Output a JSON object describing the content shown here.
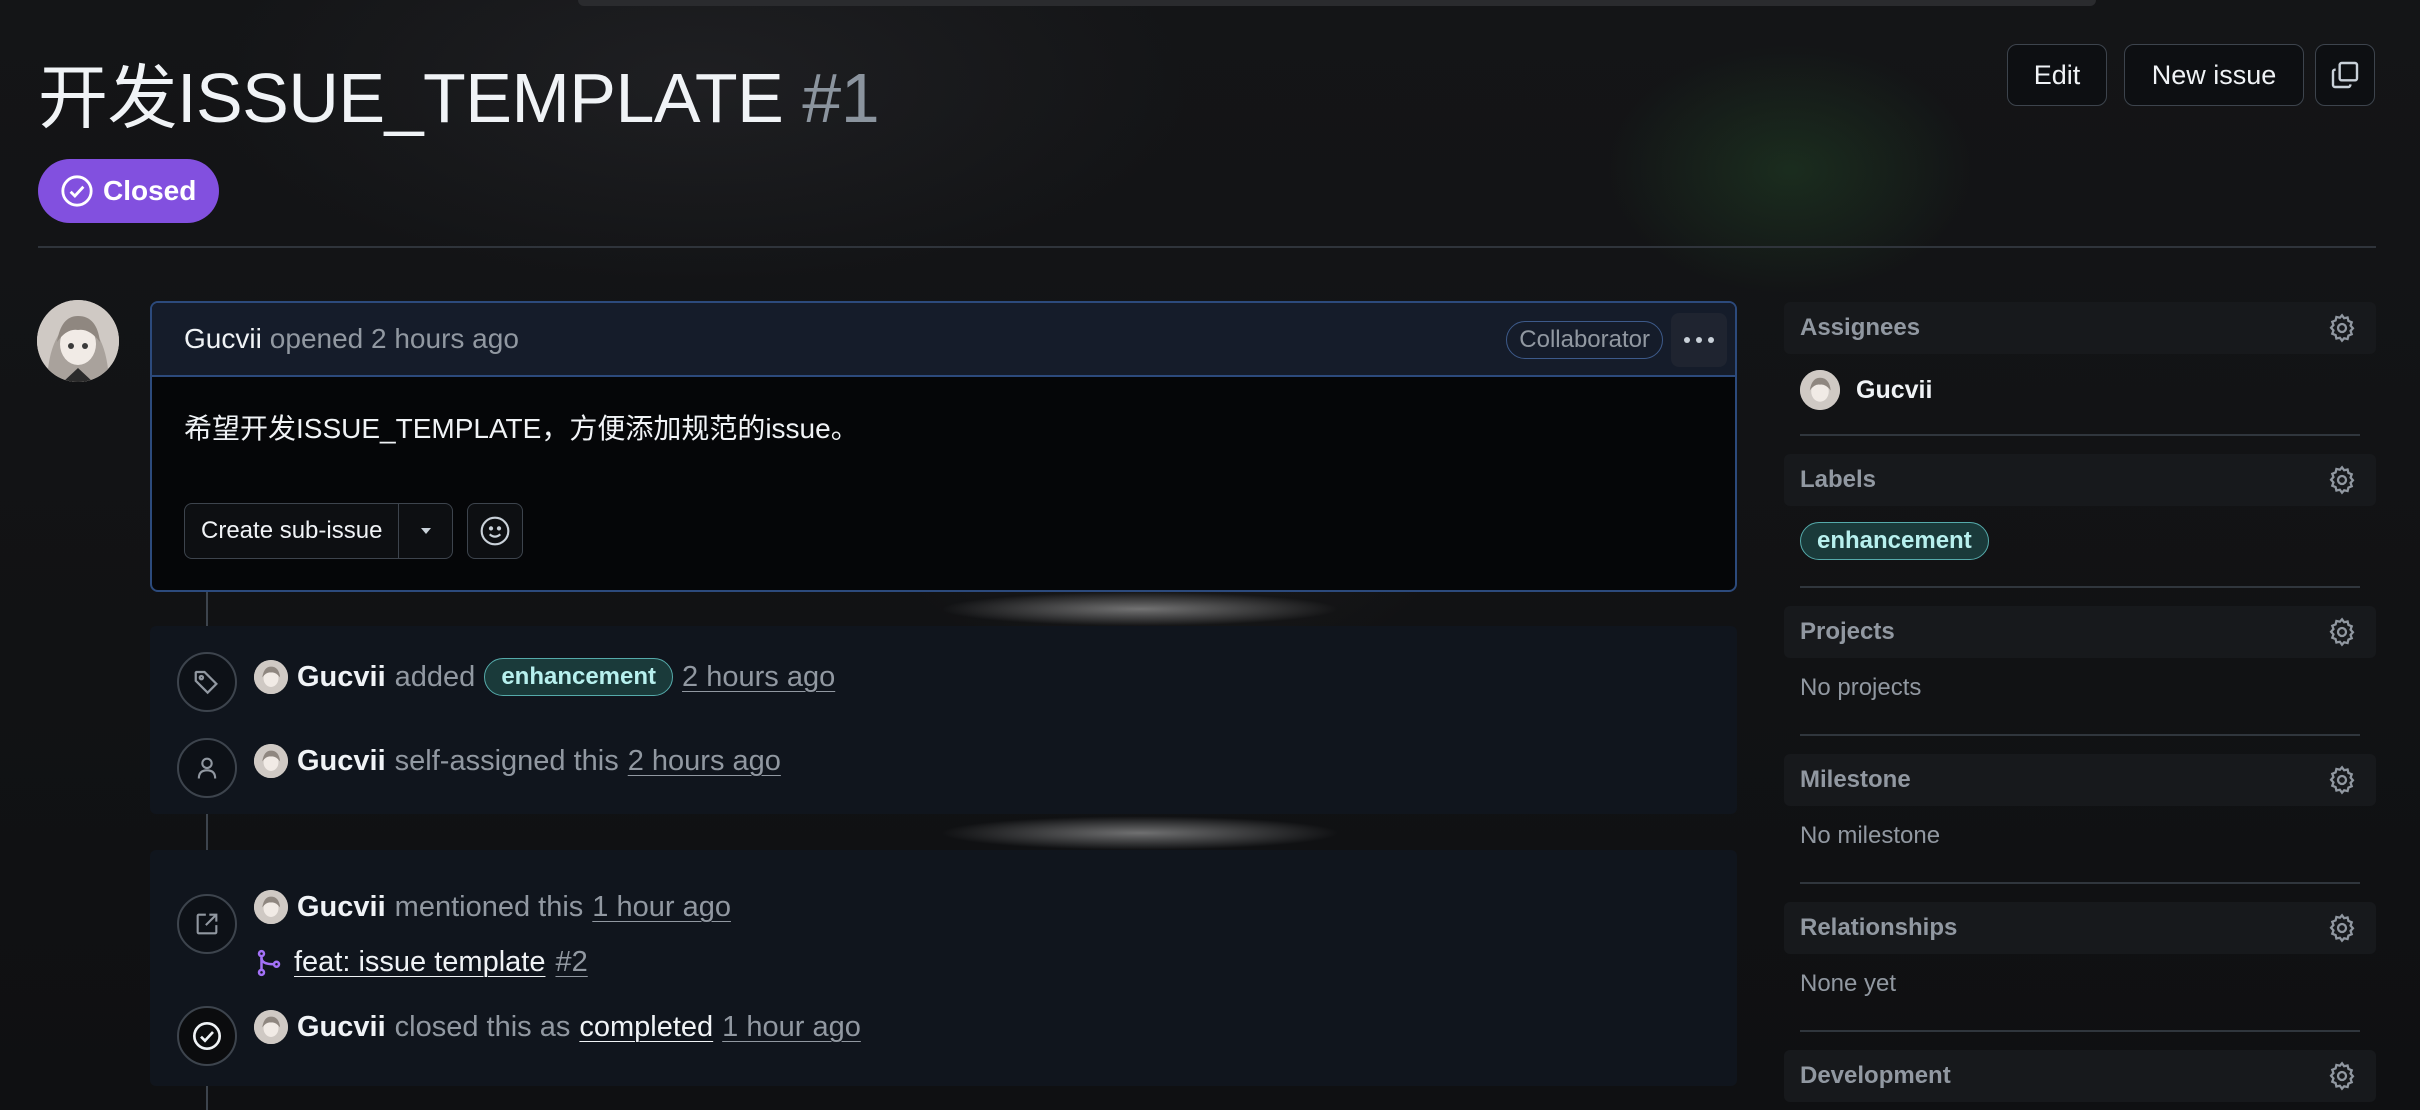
{
  "header": {
    "title": "开发ISSUE_TEMPLATE",
    "number": "#1",
    "edit_label": "Edit",
    "new_issue_label": "New issue",
    "state_label": "Closed",
    "state_color": "#8250df"
  },
  "comment": {
    "author": "Gucvii",
    "meta": "opened 2 hours ago",
    "role_badge": "Collaborator",
    "body": "希望开发ISSUE_TEMPLATE，方便添加规范的issue。",
    "create_sub_issue_label": "Create sub-issue"
  },
  "timeline": [
    {
      "icon": "tag-icon",
      "user": "Gucvii",
      "action": "added",
      "label": "enhancement",
      "time": "2 hours ago"
    },
    {
      "icon": "person-icon",
      "user": "Gucvii",
      "action": "self-assigned this",
      "time": "2 hours ago"
    },
    {
      "icon": "cross-reference-icon",
      "user": "Gucvii",
      "action": "mentioned this",
      "time": "1 hour ago",
      "ref_title": "feat: issue template",
      "ref_number": "#2"
    },
    {
      "icon": "check-circle-icon",
      "user": "Gucvii",
      "action": "closed this as",
      "link": "completed",
      "time": "1 hour ago"
    }
  ],
  "sidebar": {
    "assignees": {
      "heading": "Assignees",
      "user": "Gucvii"
    },
    "labels": {
      "heading": "Labels",
      "label": "enhancement",
      "label_color": "#55aaaa"
    },
    "projects": {
      "heading": "Projects",
      "value": "No projects"
    },
    "milestone": {
      "heading": "Milestone",
      "value": "No milestone"
    },
    "relationships": {
      "heading": "Relationships",
      "value": "None yet"
    },
    "development": {
      "heading": "Development"
    }
  }
}
